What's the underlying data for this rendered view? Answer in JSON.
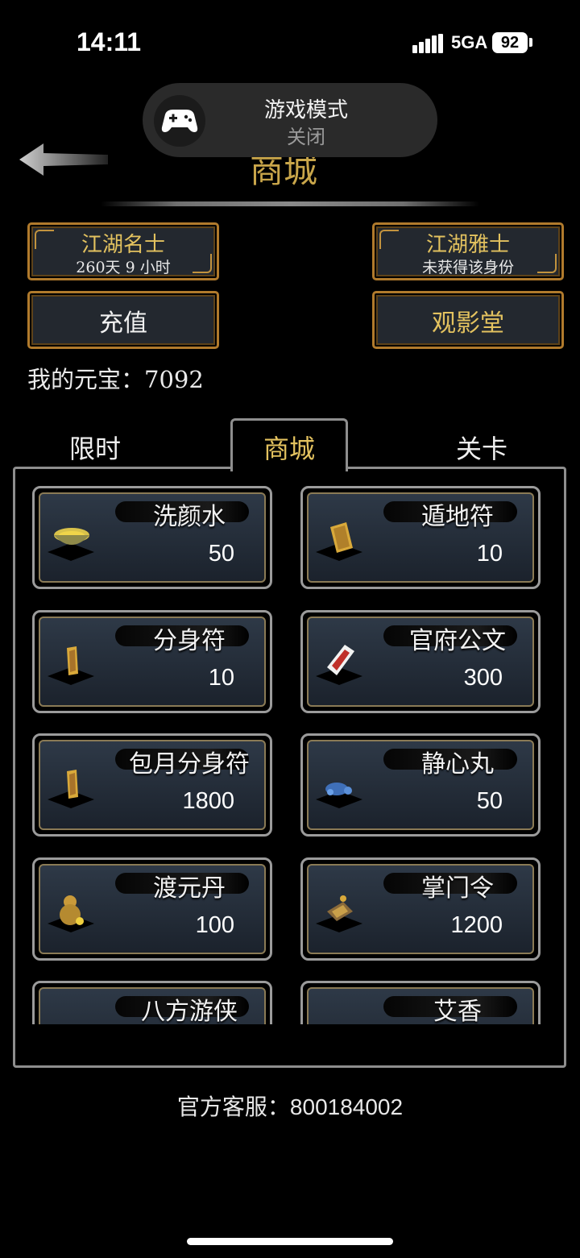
{
  "status_bar": {
    "time": "14:11",
    "network": "5GA",
    "battery": "92"
  },
  "game_mode": {
    "title": "游戏模式",
    "state": "关闭",
    "icon": "gamepad-icon"
  },
  "header": {
    "title": "商城",
    "back_icon": "back-arrow-icon"
  },
  "ranks": [
    {
      "title": "江湖名士",
      "subtitle": "260天 9 小时"
    },
    {
      "title": "江湖雅士",
      "subtitle": "未获得该身份"
    }
  ],
  "buttons": {
    "recharge": "充值",
    "theater": "观影堂"
  },
  "currency": {
    "text": "我的元宝：7092"
  },
  "tabs": [
    {
      "label": "限时",
      "active": false
    },
    {
      "label": "商城",
      "active": true
    },
    {
      "label": "关卡",
      "active": false
    }
  ],
  "items": [
    {
      "name": "洗颜水",
      "price": "50",
      "icon": "bowl-icon"
    },
    {
      "name": "遁地符",
      "price": "10",
      "icon": "talisman-icon"
    },
    {
      "name": "分身符",
      "price": "10",
      "icon": "talisman-icon"
    },
    {
      "name": "官府公文",
      "price": "300",
      "icon": "document-icon"
    },
    {
      "name": "包月分身符",
      "price": "1800",
      "icon": "talisman-icon"
    },
    {
      "name": "静心丸",
      "price": "50",
      "icon": "pill-icon"
    },
    {
      "name": "渡元丹",
      "price": "100",
      "icon": "gourd-icon"
    },
    {
      "name": "掌门令",
      "price": "1200",
      "icon": "token-icon"
    },
    {
      "name": "八方游侠",
      "price": "",
      "icon": "hero-icon"
    },
    {
      "name": "艾香",
      "price": "",
      "icon": "incense-icon"
    }
  ],
  "footer": {
    "service": "官方客服：800184002"
  },
  "colors": {
    "gold": "#e3c25f",
    "frame": "#b07a2c",
    "card_bg": "#2e3947"
  }
}
